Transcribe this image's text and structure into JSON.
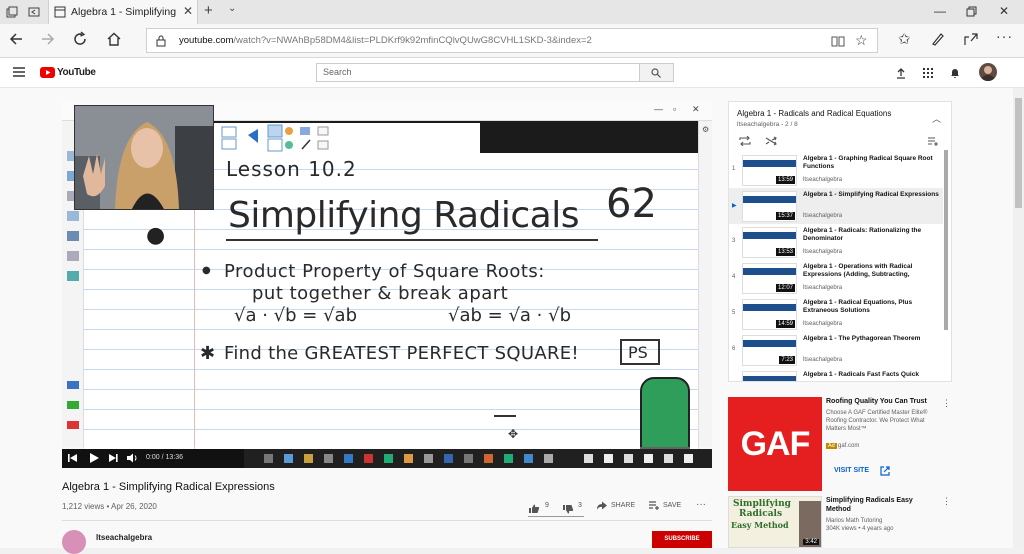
{
  "browser": {
    "tab_title": "Algebra 1 - Simplifying",
    "url_domain": "youtube.com",
    "url_path": "/watch?v=NWAhBp58DM4&list=PLDKrf9k92mfinCQlvQUwG8CVHL1SKD-3&index=2"
  },
  "youtube": {
    "logo_text": "YouTube",
    "search_placeholder": "Search"
  },
  "video": {
    "board": {
      "lesson": "Lesson 10.2",
      "heading": "Simplifying Radicals",
      "number": "62",
      "bullet1": "Product Property of Square Roots:",
      "bullet1_sub": "put together  &  break apart",
      "formula_left": "√a · √b = √ab",
      "formula_right": "√ab = √a · √b",
      "bullet2": "Find the GREATEST PERFECT SQUARE!",
      "ps_box": "PS"
    },
    "time": "0:00 / 13:36",
    "progress_fraction": 0,
    "title": "Algebra 1 - Simplifying Radical Expressions",
    "meta": "1,212 views • Apr 26, 2020",
    "likes": "9",
    "dislikes": "3",
    "share_label": "SHARE",
    "save_label": "SAVE",
    "channel": "ltseachalgebra",
    "subscribe_label": "SUBSCRIBE"
  },
  "playlist": {
    "title": "Algebra 1 - Radicals and Radical Equations",
    "subtitle": "ltseachalgebra - 2 / 8",
    "items": [
      {
        "index": "1",
        "title": "Algebra 1 - Graphing Radical Square Root Functions",
        "channel": "ltseachalgebra",
        "duration": "13:59"
      },
      {
        "index": "▶",
        "title": "Algebra 1 - Simplifying Radical Expressions",
        "channel": "ltseachalgebra",
        "duration": "15:37"
      },
      {
        "index": "3",
        "title": "Algebra 1 - Radicals: Rationalizing the Denominator",
        "channel": "ltseachalgebra",
        "duration": "13:53"
      },
      {
        "index": "4",
        "title": "Algebra 1 - Operations with Radical Expressions (Adding, Subtracting,",
        "channel": "ltseachalgebra",
        "duration": "12:07"
      },
      {
        "index": "5",
        "title": "Algebra 1 - Radical Equations, Plus Extraneous Solutions",
        "channel": "ltseachalgebra",
        "duration": "14:59"
      },
      {
        "index": "6",
        "title": "Algebra 1 - The Pythagorean Theorem",
        "channel": "ltseachalgebra",
        "duration": "7:23"
      },
      {
        "index": "7",
        "title": "Algebra 1 - Radicals Fast Facts Quick",
        "channel": "",
        "duration": ""
      }
    ]
  },
  "ad": {
    "logo": "GAF",
    "title": "Roofing Quality You Can Trust",
    "description": "Choose A GAF Certified Master Elite® Roofing Contractor. We Protect What Matters Most™",
    "badge": "Ad",
    "domain": "gaf.com",
    "visit_label": "VISIT SITE"
  },
  "recommendation": {
    "thumb_line1": "Simplifying",
    "thumb_line2": "Radicals",
    "thumb_line3": "Easy Method",
    "duration": "3:42",
    "title": "Simplifying Radicals Easy Method",
    "channel": "Marios Math Tutoring",
    "meta": "304K views • 4 years ago"
  }
}
